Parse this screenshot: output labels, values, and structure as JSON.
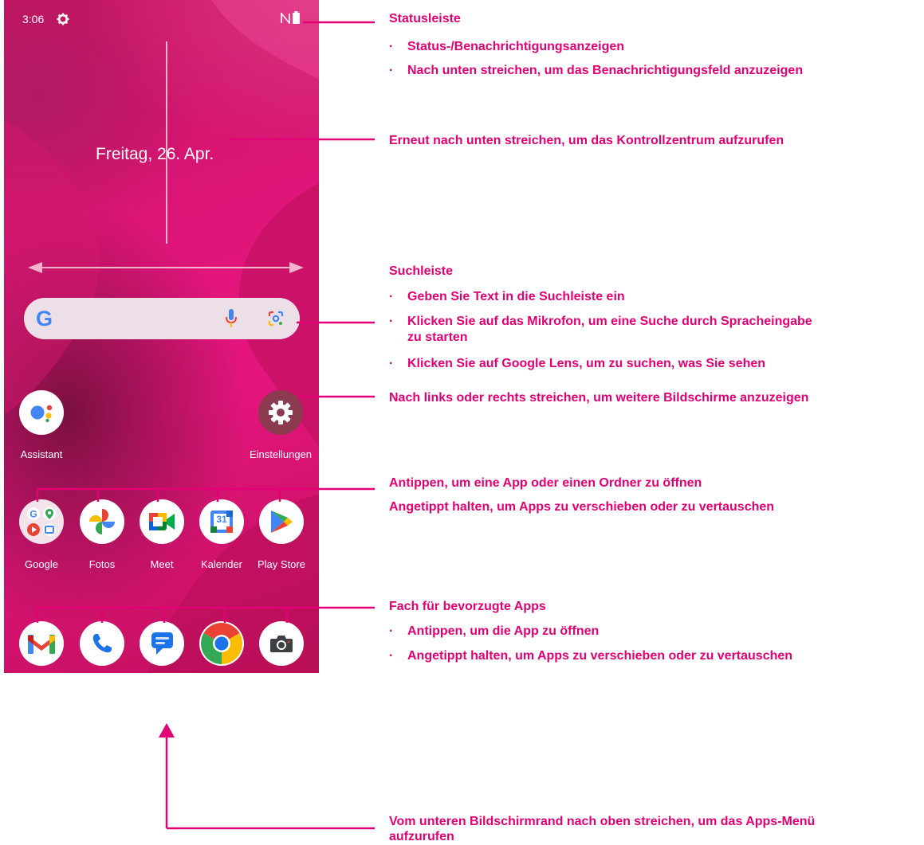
{
  "status_bar": {
    "time": "3:06"
  },
  "date_widget": "Freitag, 26. Apr.",
  "search": {
    "google_letter": "G"
  },
  "home_icons": {
    "assistant": "Assistant",
    "settings": "Einstellungen"
  },
  "apps": [
    "Google",
    "Fotos",
    "Meet",
    "Kalender",
    "Play Store"
  ],
  "calendar_day": "31",
  "colors": {
    "accent": "#e20074",
    "wallpaper": "#e0157a"
  },
  "annotations": {
    "status_title": "Statusleiste",
    "status_b1": "Status-/Benachrichtigungsanzeigen",
    "status_b2": "Nach unten streichen, um das Benachrichtigungsfeld anzuzeigen",
    "control_center": "Erneut nach unten streichen, um das Kontrollzentrum aufzurufen",
    "search_title": "Suchleiste",
    "search_b1": "Geben Sie Text in die Suchleiste ein",
    "search_b2a": "Klicken Sie auf das Mikrofon, um eine Suche durch Spracheingabe",
    "search_b2b": "zu starten",
    "search_b3": "Klicken Sie auf Google Lens, um zu suchen, was Sie sehen",
    "swipe_screens": "Nach links oder rechts streichen, um weitere Bildschirme anzuzeigen",
    "tap_open": "Antippen, um eine App oder einen Ordner zu öffnen",
    "hold_move": "Angetippt halten, um Apps zu verschieben oder zu vertauschen",
    "tray_title": "Fach für bevorzugte Apps",
    "tray_b1": "Antippen, um die App zu öffnen",
    "tray_b2": "Angetippt halten, um Apps zu verschieben oder zu vertauschen",
    "apps_menu_a": "Vom unteren Bildschirmrand nach oben streichen, um das Apps-Menü",
    "apps_menu_b": "aufzurufen",
    "bullet_char": "·"
  }
}
